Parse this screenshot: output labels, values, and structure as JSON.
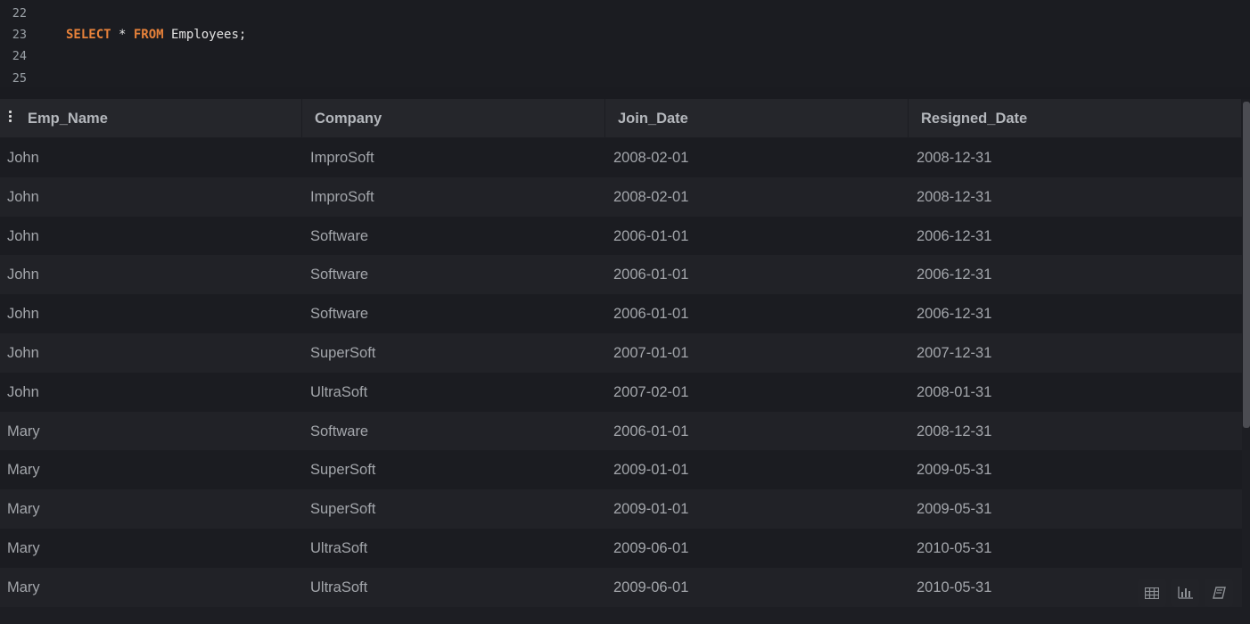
{
  "editor": {
    "lines": [
      {
        "num": "22",
        "tokens": []
      },
      {
        "num": "23",
        "tokens": [
          {
            "text": "SELECT",
            "kw": true
          },
          {
            "text": " * ",
            "kw": false
          },
          {
            "text": "FROM",
            "kw": true
          },
          {
            "text": " Employees;",
            "kw": false
          }
        ]
      },
      {
        "num": "24",
        "tokens": []
      },
      {
        "num": "25",
        "tokens": []
      }
    ]
  },
  "results": {
    "columns": [
      "Emp_Name",
      "Company",
      "Join_Date",
      "Resigned_Date"
    ],
    "rows": [
      [
        "John",
        "ImproSoft",
        "2008-02-01",
        "2008-12-31"
      ],
      [
        "John",
        "ImproSoft",
        "2008-02-01",
        "2008-12-31"
      ],
      [
        "John",
        "Software",
        "2006-01-01",
        "2006-12-31"
      ],
      [
        "John",
        "Software",
        "2006-01-01",
        "2006-12-31"
      ],
      [
        "John",
        "Software",
        "2006-01-01",
        "2006-12-31"
      ],
      [
        "John",
        "SuperSoft",
        "2007-01-01",
        "2007-12-31"
      ],
      [
        "John",
        "UltraSoft",
        "2007-02-01",
        "2008-01-31"
      ],
      [
        "Mary",
        "Software",
        "2006-01-01",
        "2008-12-31"
      ],
      [
        "Mary",
        "SuperSoft",
        "2009-01-01",
        "2009-05-31"
      ],
      [
        "Mary",
        "SuperSoft",
        "2009-01-01",
        "2009-05-31"
      ],
      [
        "Mary",
        "UltraSoft",
        "2009-06-01",
        "2010-05-31"
      ],
      [
        "Mary",
        "UltraSoft",
        "2009-06-01",
        "2010-05-31"
      ]
    ]
  },
  "toolbar": {
    "buttons": [
      {
        "icon": "table-icon"
      },
      {
        "icon": "bar-chart-icon"
      },
      {
        "icon": "book-icon"
      }
    ]
  },
  "colors": {
    "keyword": "#e8823a",
    "background": "#1b1c21",
    "row_alt": "#212227",
    "header": "#25262b"
  }
}
